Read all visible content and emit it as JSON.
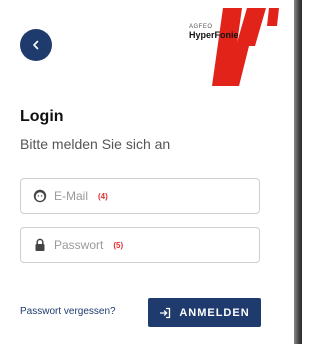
{
  "header": {
    "back_icon": "chevron-left-icon",
    "logo": {
      "brand": "AGFEO",
      "product": "HyperFonie",
      "badge": "cloud"
    }
  },
  "form": {
    "title": "Login",
    "subtitle": "Bitte melden Sie sich an",
    "email": {
      "placeholder": "E-Mail",
      "marker": "(4)",
      "icon": "user-face-icon"
    },
    "password": {
      "placeholder": "Passwort",
      "marker": "(5)",
      "icon": "lock-icon"
    },
    "forgot_label": "Passwort vergessen?",
    "submit_label": "ANMELDEN",
    "submit_icon": "login-arrow-icon"
  },
  "colors": {
    "primary": "#1f3b6e",
    "logo_red": "#e2231a",
    "marker_red": "#e03030",
    "border": "#cfcfcf"
  }
}
